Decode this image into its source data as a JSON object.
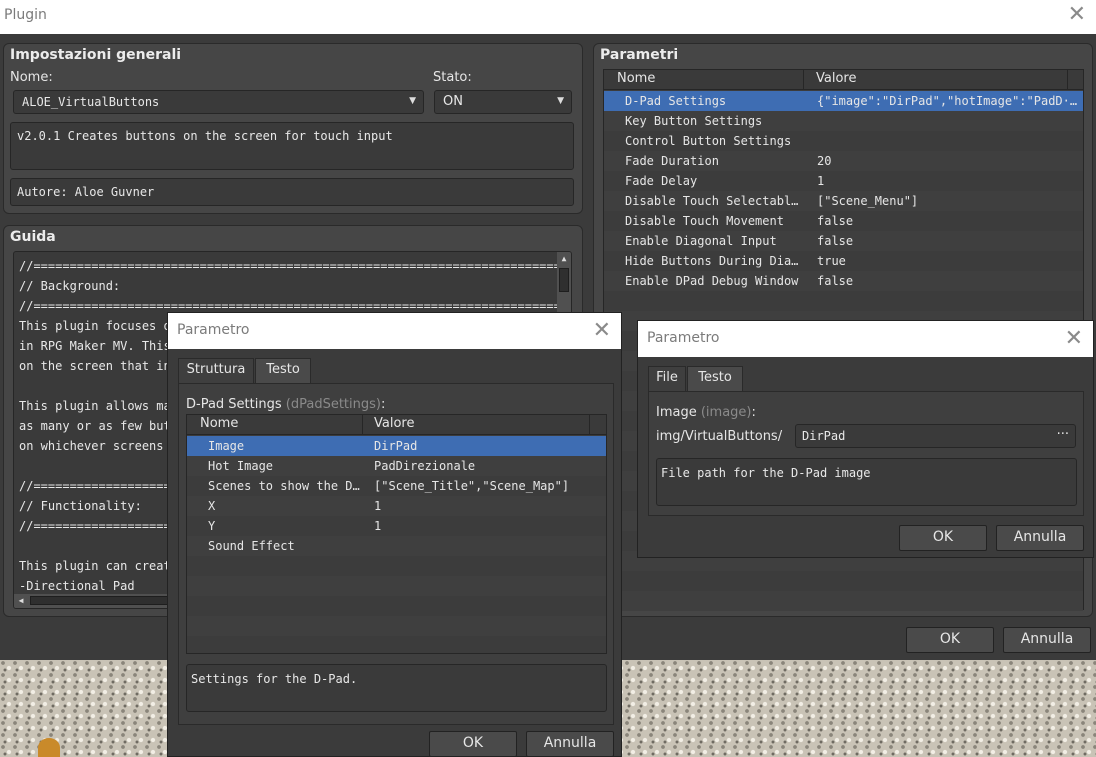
{
  "window": {
    "title": "Plugin"
  },
  "general": {
    "title": "Impostazioni generali",
    "name_label": "Nome:",
    "name_value": "ALOE_VirtualButtons",
    "status_label": "Stato:",
    "status_value": "ON",
    "description": "v2.0.1 Creates buttons on the screen for touch input",
    "author": "Autore: Aloe Guvner"
  },
  "guide": {
    "title": "Guida",
    "lines": [
      "//=============================================================================",
      "// Background:",
      "//=============================================================================",
      "This plugin focuses or",
      "in RPG Maker MV. This",
      "on the screen that int",
      "",
      "This plugin allows max",
      "as many or as few butt",
      "on whichever screens y",
      "",
      "//===================",
      "// Functionality:",
      "//===================",
      "",
      "This plugin can create",
      "-Directional Pad"
    ]
  },
  "params": {
    "title": "Parametri",
    "col_name": "Nome",
    "col_value": "Valore",
    "rows": [
      {
        "name": "D-Pad Settings",
        "value": "{\"image\":\"DirPad\",\"hotImage\":\"PadD···"
      },
      {
        "name": "Key Button Settings",
        "value": ""
      },
      {
        "name": "Control Button Settings",
        "value": ""
      },
      {
        "name": "Fade Duration",
        "value": "20"
      },
      {
        "name": "Fade Delay",
        "value": "1"
      },
      {
        "name": "Disable Touch Selectable···",
        "value": "[\"Scene_Menu\"]"
      },
      {
        "name": "Disable Touch Movement",
        "value": "false"
      },
      {
        "name": "Enable Diagonal Input",
        "value": "false"
      },
      {
        "name": "Hide Buttons During Dial···",
        "value": "true"
      },
      {
        "name": "Enable DPad Debug Window",
        "value": "false"
      }
    ]
  },
  "main_buttons": {
    "ok": "OK",
    "cancel": "Annulla"
  },
  "dialog1": {
    "title": "Parametro",
    "tab_structure": "Struttura",
    "tab_text": "Testo",
    "struct_label": "D-Pad Settings",
    "struct_key": "(dPadSettings)",
    "struct_colon": ":",
    "col_name": "Nome",
    "col_value": "Valore",
    "rows": [
      {
        "name": "Image",
        "value": "DirPad"
      },
      {
        "name": "Hot Image",
        "value": "PadDirezionale"
      },
      {
        "name": "Scenes to show the D···",
        "value": "[\"Scene_Title\",\"Scene_Map\"]"
      },
      {
        "name": "X",
        "value": "1"
      },
      {
        "name": "Y",
        "value": "1"
      },
      {
        "name": "Sound Effect",
        "value": ""
      }
    ],
    "description": "Settings for the D-Pad.",
    "ok": "OK",
    "cancel": "Annulla"
  },
  "dialog2": {
    "title": "Parametro",
    "tab_file": "File",
    "tab_text": "Testo",
    "field_label": "Image",
    "field_key": "(image)",
    "field_colon": ":",
    "path_prefix": "img/VirtualButtons/",
    "path_value": "DirPad",
    "browse": "···",
    "description": "File path for the D-Pad image",
    "ok": "OK",
    "cancel": "Annulla"
  },
  "colors": {
    "selection": "#3e6db3",
    "panel": "#464646",
    "background": "#3b3b3b"
  }
}
